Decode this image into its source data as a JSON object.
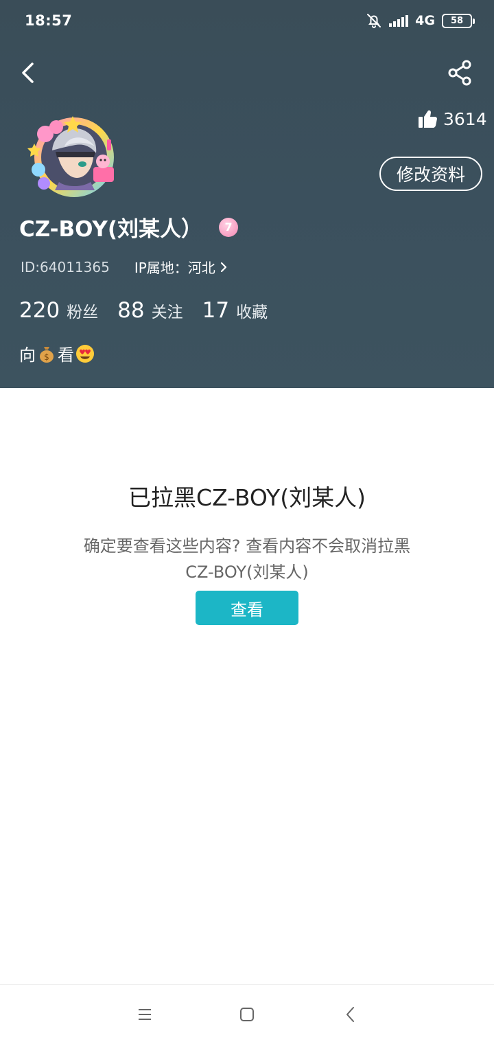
{
  "status_bar": {
    "time": "18:57",
    "network": "4G",
    "battery": "58"
  },
  "profile": {
    "likes": "3614",
    "edit_label": "修改资料",
    "username": "CZ-BOY(刘某人）",
    "level": "7",
    "id_text": "ID:64011365",
    "ip_text": "IP属地：河北",
    "stats": [
      {
        "num": "220",
        "label": "粉丝"
      },
      {
        "num": "88",
        "label": "关注"
      },
      {
        "num": "17",
        "label": "收藏"
      }
    ],
    "bio_prefix": "向",
    "bio_middle": "看"
  },
  "blocked": {
    "title": "已拉黑CZ-BOY(刘某人)",
    "desc_line1": "确定要查看这些内容? 查看内容不会取消拉黑",
    "desc_line2": "CZ-BOY(刘某人)",
    "view_label": "查看"
  },
  "colors": {
    "header_bg": "#3b505d",
    "accent": "#1cb6c6"
  }
}
